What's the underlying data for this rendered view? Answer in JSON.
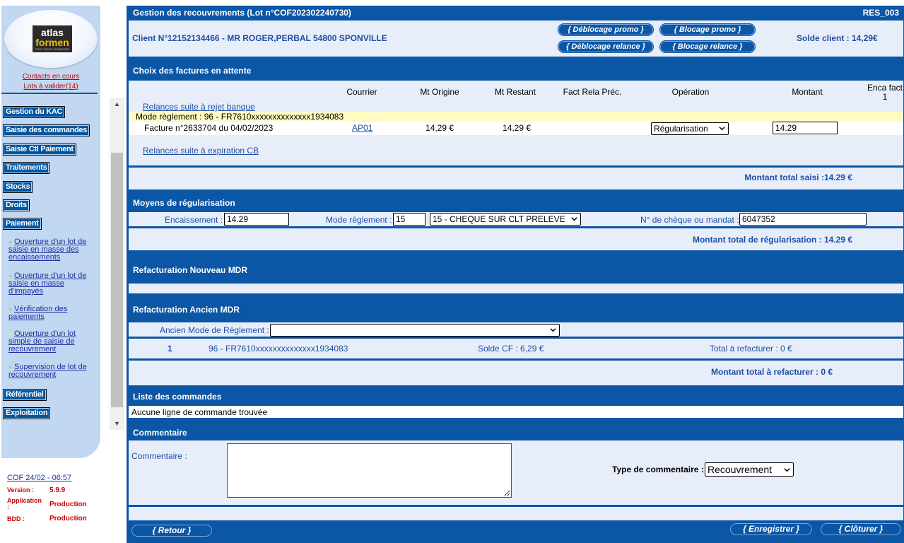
{
  "sidebar": {
    "logo": {
      "line1": "atlas",
      "line2": "formen",
      "line3": "TOUT POUR L'ENSEIGNE"
    },
    "contacts_link": "Contacts en cours",
    "lots_link": "Lots à valider(14)",
    "nav": [
      "Gestion du KAC",
      "Saisie des commandes",
      "Saisie Ctl Paiement",
      "Traitements",
      "Stocks",
      "Droits",
      "Paiement"
    ],
    "sub_items": [
      [
        "Ouverture d'un lot de",
        "saisie en masse des",
        "encaissements"
      ],
      [
        "Ouverture d'un lot de",
        "saisie en masse",
        "d'impayés"
      ],
      [
        "Vérification des",
        "paiements"
      ],
      [
        "Ouverture d'un lot",
        "simple de saisie de",
        "recouvrement"
      ],
      [
        "Supervision de lot de",
        "recouvrement"
      ]
    ],
    "nav_bottom": [
      "Référentiel",
      "Exploitation"
    ],
    "info": {
      "cof_date": "COF 24/02 - 06:57",
      "version_label": "Version :",
      "version_value": "5.9.9",
      "app_label_1": "Application",
      "app_label_2": ":",
      "app_value": "Production",
      "bdd_label": "BDD :",
      "bdd_value": "Production"
    }
  },
  "header": {
    "title": "Gestion des recouvrements (Lot n°COF202302240730)",
    "code": "RES_003",
    "client": "Client N°12152134466 - MR ROGER,PERBAL 54800 SPONVILLE",
    "btn_deblocage_promo": "{ Déblocage promo }",
    "btn_blocage_promo": "{   Blocage promo   }",
    "btn_deblocage_relance": "{ Déblocage relance }",
    "btn_blocage_relance": "{ Blocage relance }",
    "solde": "Solde client : 14,29€"
  },
  "factures": {
    "title": "Choix des factures en attente",
    "columns": {
      "courrier": "Courrier",
      "mt_origine": "Mt Origine",
      "mt_restant": "Mt Restant",
      "fact_rela": "Fact Rela Préc.",
      "operation": "Opération",
      "montant": "Montant",
      "enca_1": "Enca fact",
      "enca_2": "1"
    },
    "relances_rejet": "Relances suite à rejet banque",
    "mode_reglement": "Mode règlement : 96 - FR7610xxxxxxxxxxxxxx1934083",
    "row": {
      "facture": "Facture n°2633704 du 04/02/2023",
      "courrier": "AP01",
      "mt_origine": "14,29 €",
      "mt_restant": "14,29 €",
      "operation": "Régularisation",
      "montant": "14.29"
    },
    "relances_cb": "Relances suite à expiration CB",
    "total": "Montant total saisi :14.29 €"
  },
  "moyens": {
    "title": "Moyens de régularisation",
    "encaissement_label": "Encaissement :",
    "encaissement_value": "14.29",
    "mode_label": "Mode règlement :",
    "mode_code": "15",
    "mode_select": "15 - CHEQUE SUR CLT PRELEVE",
    "cheque_label": "N° de chèque ou mandat :",
    "cheque_value": "6047352",
    "total": "Montant total de régularisation : 14.29 €"
  },
  "refact_nouveau": {
    "title": "Refacturation Nouveau MDR"
  },
  "refact_ancien": {
    "title": "Refacturation Ancien MDR",
    "ancien_label": "Ancien Mode de Règlement :",
    "ancien_value": "",
    "row_num": "1",
    "row_mode": "96 - FR7610xxxxxxxxxxxxxx1934083",
    "row_solde": "Solde CF : 6,29 €",
    "row_total": "Total à refacturer : 0 €",
    "total": "Montant total à refacturer : 0 €"
  },
  "commandes": {
    "title": "Liste des commandes",
    "empty": "Aucune ligne de commande trouvée"
  },
  "commentaire": {
    "title": "Commentaire",
    "label": "Commentaire :",
    "value": "",
    "type_label": "Type de commentaire :",
    "type_value": "Recouvrement"
  },
  "footer": {
    "retour": "{    Retour    }",
    "enregistrer": "{ Enregistrer }",
    "cloturer": "{   Clôturer   }"
  }
}
